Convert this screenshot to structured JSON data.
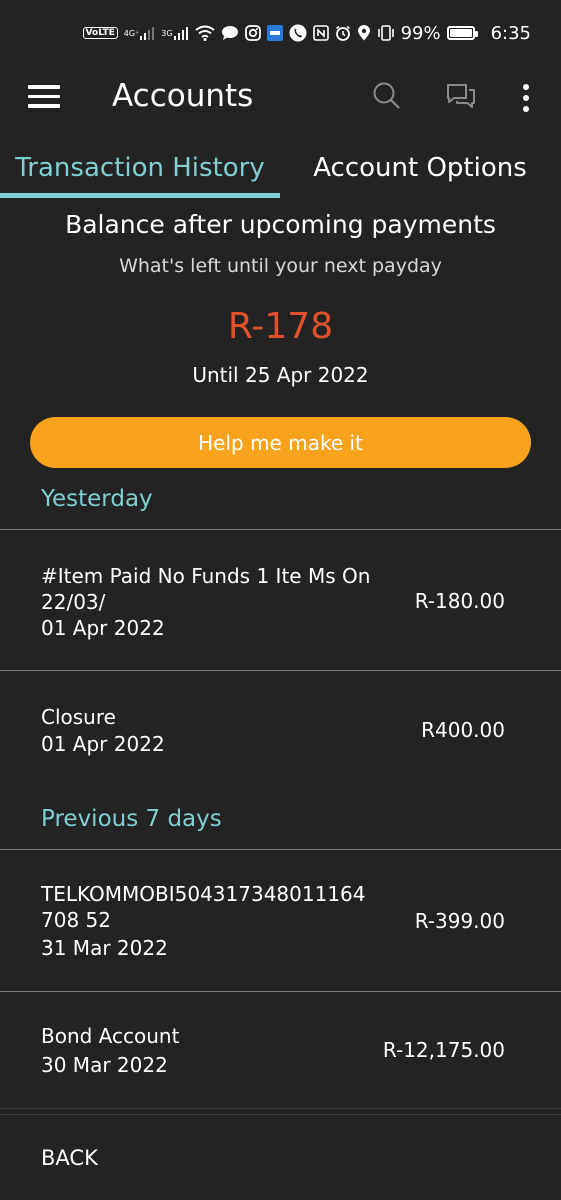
{
  "status_bar": {
    "volte": "VoLTE",
    "net1": "4G⁺",
    "net2": "3G",
    "battery": "99%",
    "time": "6:35"
  },
  "app_bar": {
    "title": "Accounts",
    "icons": [
      "menu-icon",
      "search-icon",
      "chat-icon",
      "more-vert-icon"
    ]
  },
  "tabs": [
    {
      "label": "Transaction History",
      "active": true
    },
    {
      "label": "Account Options",
      "active": false
    }
  ],
  "balance": {
    "title": "Balance after upcoming payments",
    "subtitle": "What's left until your next payday",
    "amount": "R-178",
    "until": "Until 25 Apr 2022",
    "amount_color": "#e0512b"
  },
  "help_button": {
    "label": "Help me make it",
    "color": "#f9a21c"
  },
  "sections": [
    {
      "header": "Yesterday",
      "transactions": [
        {
          "description": "#Item Paid No Funds 1 Ite Ms On 22/03/",
          "date": "01 Apr 2022",
          "amount": "R-180.00"
        },
        {
          "description": "Closure",
          "date": "01 Apr 2022",
          "amount": "R400.00"
        }
      ]
    },
    {
      "header": "Previous 7 days",
      "transactions": [
        {
          "description": "TELKOMMOBI504317348011164708 52",
          "date": "31 Mar 2022",
          "amount": "R-399.00"
        },
        {
          "description": "Bond Account",
          "date": "30 Mar 2022",
          "amount": "R-12,175.00"
        }
      ]
    }
  ],
  "footer": {
    "back_label": "BACK"
  },
  "colors": {
    "background": "#232323",
    "accent": "#7fcfd3"
  }
}
